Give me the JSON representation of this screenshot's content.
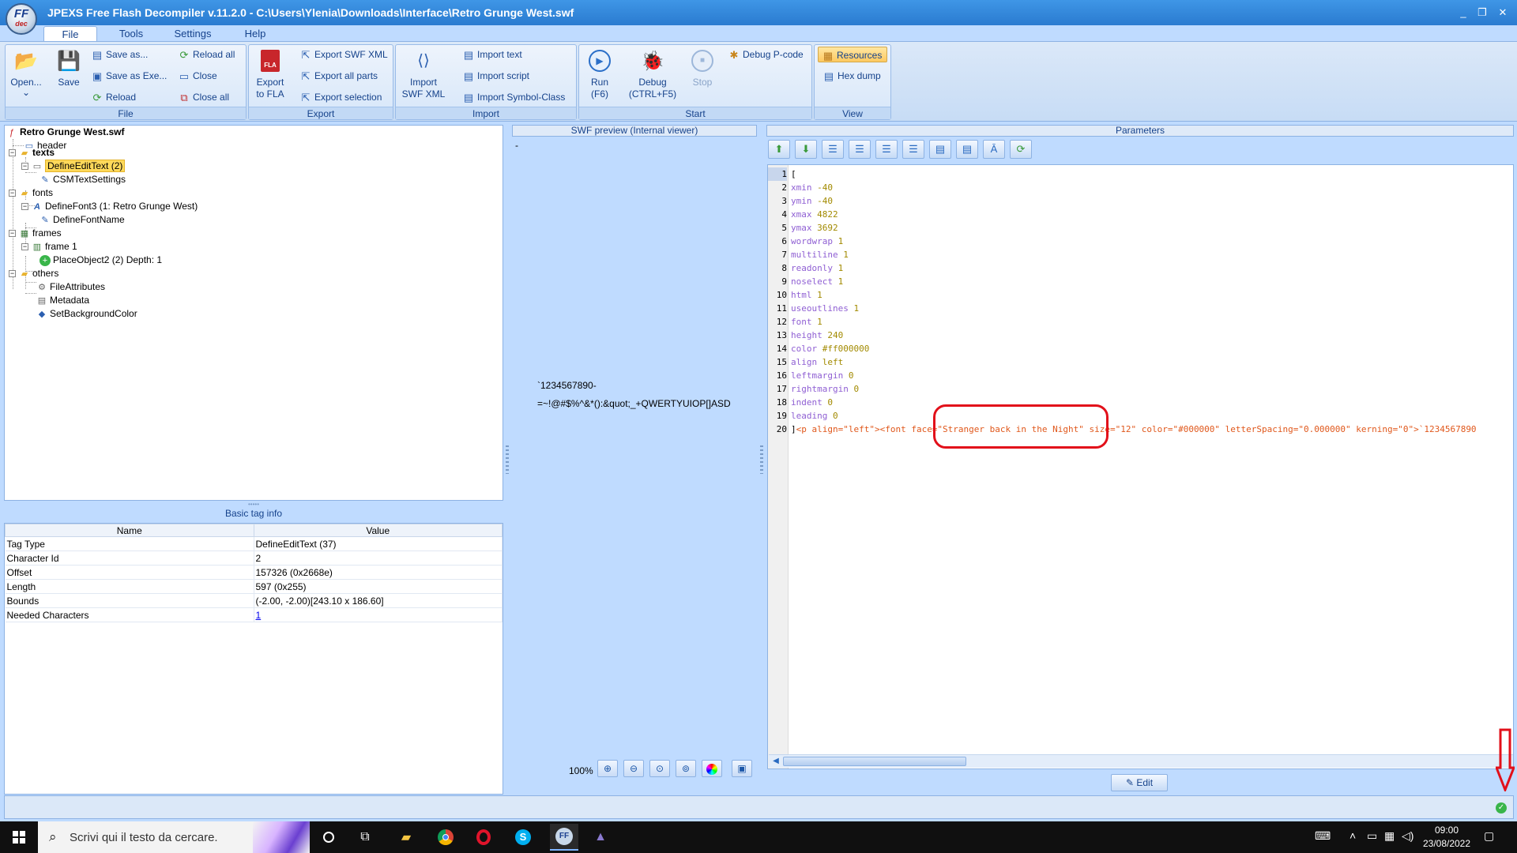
{
  "window": {
    "title": "JPEXS Free Flash Decompiler v.11.2.0 - C:\\Users\\Ylenia\\Downloads\\Interface\\Retro Grunge West.swf",
    "logo_top": "FF",
    "logo_bottom": "dec",
    "minimize": "_",
    "restore": "❐",
    "close": "✕"
  },
  "menu": {
    "tabs": [
      "File",
      "Tools",
      "Settings",
      "Help"
    ],
    "active": "File"
  },
  "ribbon": {
    "file": {
      "label": "File",
      "open": "Open...",
      "open_arrow": "⌄",
      "save": "Save",
      "save_as": "Save as...",
      "save_as_exe": "Save as Exe...",
      "reload": "Reload",
      "reload_all": "Reload all",
      "close": "Close",
      "close_all": "Close all"
    },
    "export": {
      "label": "Export",
      "export_to_fla_1": "Export",
      "export_to_fla_2": "to FLA",
      "export_swf_xml": "Export SWF XML",
      "export_all_parts": "Export all parts",
      "export_selection": "Export selection"
    },
    "import": {
      "label": "Import",
      "import_swf_xml_1": "Import",
      "import_swf_xml_2": "SWF XML",
      "import_text": "Import text",
      "import_script": "Import script",
      "import_symbol_class": "Import Symbol-Class"
    },
    "start": {
      "label": "Start",
      "run_1": "Run",
      "run_2": "(F6)",
      "debug_1": "Debug",
      "debug_2": "(CTRL+F5)",
      "stop": "Stop",
      "debug_pcode": "Debug P-code"
    },
    "view": {
      "label": "View",
      "resources": "Resources",
      "hex_dump": "Hex dump"
    }
  },
  "tree": {
    "root": "Retro Grunge West.swf",
    "header": "header",
    "texts": "texts",
    "define_edit_text": "DefineEditText (2)",
    "csm_text_settings": "CSMTextSettings",
    "fonts": "fonts",
    "define_font3": "DefineFont3 (1: Retro Grunge West)",
    "define_font_name": "DefineFontName",
    "frames": "frames",
    "frame1": "frame 1",
    "place_object2": "PlaceObject2 (2) Depth: 1",
    "others": "others",
    "file_attributes": "FileAttributes",
    "metadata": "Metadata",
    "set_background_color": "SetBackgroundColor"
  },
  "basic_info": {
    "grip": "•••••",
    "title": "Basic tag info",
    "col_name": "Name",
    "col_value": "Value",
    "rows": [
      {
        "name": "Tag Type",
        "value": "DefineEditText (37)"
      },
      {
        "name": "Character Id",
        "value": "2"
      },
      {
        "name": "Offset",
        "value": "157326 (0x2668e)"
      },
      {
        "name": "Length",
        "value": "597 (0x255)"
      },
      {
        "name": "Bounds",
        "value": "(-2.00, -2.00)[243.10 x 186.60]"
      },
      {
        "name": "Needed Characters",
        "value": "1"
      }
    ]
  },
  "preview": {
    "title": "SWF preview (Internal viewer)",
    "dash": "-",
    "line1": "`1234567890-",
    "line2": "=~!@#$%^&*():&quot;_+QWERTYUIOP[]ASD",
    "zoom": "100%"
  },
  "parameters": {
    "title": "Parameters",
    "lines": [
      {
        "n": "1",
        "k": "[",
        "v": ""
      },
      {
        "n": "2",
        "k": "xmin",
        "v": "-40"
      },
      {
        "n": "3",
        "k": "ymin",
        "v": "-40"
      },
      {
        "n": "4",
        "k": "xmax",
        "v": "4822"
      },
      {
        "n": "5",
        "k": "ymax",
        "v": "3692"
      },
      {
        "n": "6",
        "k": "wordwrap",
        "v": "1"
      },
      {
        "n": "7",
        "k": "multiline",
        "v": "1"
      },
      {
        "n": "8",
        "k": "readonly",
        "v": "1"
      },
      {
        "n": "9",
        "k": "noselect",
        "v": "1"
      },
      {
        "n": "10",
        "k": "html",
        "v": "1"
      },
      {
        "n": "11",
        "k": "useoutlines",
        "v": "1"
      },
      {
        "n": "12",
        "k": "font",
        "v": "1"
      },
      {
        "n": "13",
        "k": "height",
        "v": "240"
      },
      {
        "n": "14",
        "k": "color",
        "v": "#ff000000"
      },
      {
        "n": "15",
        "k": "align",
        "v": "left"
      },
      {
        "n": "16",
        "k": "leftmargin",
        "v": "0"
      },
      {
        "n": "17",
        "k": "rightmargin",
        "v": "0"
      },
      {
        "n": "18",
        "k": "indent",
        "v": "0"
      },
      {
        "n": "19",
        "k": "leading",
        "v": "0"
      }
    ],
    "last_line_no": "20",
    "last_line_prefix": "]",
    "last_line_html": "<p align=\"left\"><font face=\"Stranger back in the Night\" size=\"12\" color=\"#000000\" letterSpacing=\"0.000000\" kerning=\"0\">`1234567890",
    "edit_button": "Edit"
  },
  "taskbar": {
    "search_placeholder": "Scrivi qui il testo da cercare.",
    "time": "09:00",
    "date": "23/08/2022"
  },
  "colors": {
    "accent": "#2a7bd0",
    "ribbon_text": "#15428b",
    "annotation": "#e2101a",
    "selected": "#ffd95a"
  }
}
